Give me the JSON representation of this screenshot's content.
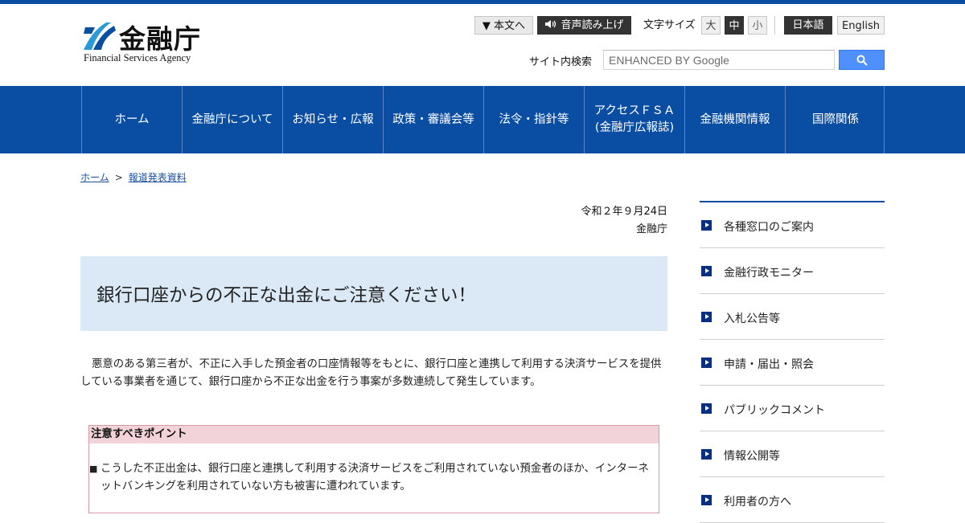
{
  "header": {
    "logo_jp": "金融庁",
    "logo_en": "Financial Services Agency",
    "skip_to_content": "▼ 本文へ",
    "read_aloud": "音声読み上げ",
    "font_size_label": "文字サイズ",
    "font_size_large": "大",
    "font_size_medium": "中",
    "font_size_small": "小",
    "lang_ja": "日本語",
    "lang_en": "English",
    "search_label": "サイト内検索",
    "search_placeholder": "ENHANCED BY Google"
  },
  "nav": {
    "items": [
      {
        "label": "ホーム"
      },
      {
        "label": "金融庁について"
      },
      {
        "label": "お知らせ・広報"
      },
      {
        "label": "政策・審議会等"
      },
      {
        "label": "法令・指針等"
      },
      {
        "label": "アクセスＦＳＡ\n(金融庁広報誌)"
      },
      {
        "label": "金融機関情報"
      },
      {
        "label": "国際関係"
      }
    ]
  },
  "breadcrumb": {
    "home": "ホーム",
    "separator": ">",
    "current": "報道発表資料"
  },
  "article": {
    "date": "令和２年９月24日",
    "department": "金融庁",
    "title": "銀行口座からの不正な出金にご注意ください！",
    "body": "悪意のある第三者が、不正に入手した預金者の口座情報等をもとに、銀行口座と連携して利用する決済サービスを提供している事業者を通じて、銀行口座から不正な出金を行う事案が多数連続して発生しています。",
    "notice_heading": "注意すべきポイント",
    "notice_bullet": "■",
    "notice_item_1": "こうした不正出金は、銀行口座と連携して利用する決済サービスをご利用されていない預金者のほか、インターネットバンキングを利用されていない方も被害に遭われています。"
  },
  "sidebar": {
    "items": [
      {
        "label": "各種窓口のご案内"
      },
      {
        "label": "金融行政モニター"
      },
      {
        "label": "入札公告等"
      },
      {
        "label": "申請・届出・照会"
      },
      {
        "label": "パブリックコメント"
      },
      {
        "label": "情報公開等"
      },
      {
        "label": "利用者の方へ"
      }
    ]
  },
  "colors": {
    "brand_blue": "#0a4ea3",
    "title_bg": "#dbe9f7",
    "notice_header_bg": "#f2d3d9",
    "notice_border": "#d69aa6",
    "search_button": "#4d90fe"
  }
}
